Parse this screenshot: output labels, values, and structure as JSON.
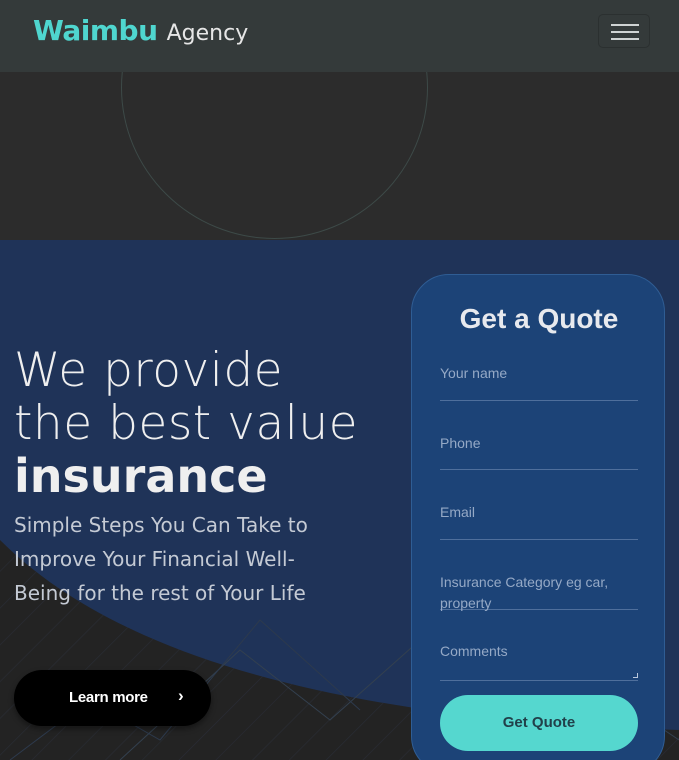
{
  "navbar": {
    "brand_name": "Waimbu",
    "brand_suffix": "Agency",
    "menu_icon": "hamburger-menu-icon"
  },
  "hero": {
    "headline_line1": "We provide",
    "headline_line2": "the best value",
    "headline_bold": "insurance",
    "subtext": "Simple Steps You Can Take to Improve Your Financial Well-Being for the rest of Your Life",
    "cta_label": "Learn more",
    "cta_icon": "chevron-right-icon"
  },
  "quote_form": {
    "title": "Get a Quote",
    "fields": {
      "name": "Your name",
      "phone": "Phone",
      "email": "Email",
      "category": "Insurance Category eg car, property",
      "comments": "Comments"
    },
    "submit_label": "Get Quote"
  },
  "colors": {
    "accent": "#55d7cf",
    "brand": "#4fd6cf",
    "navbar_bg": "#343a3a",
    "section_bg": "#1f3358",
    "card_bg": "#1c4377",
    "cta_bg": "#000000"
  }
}
